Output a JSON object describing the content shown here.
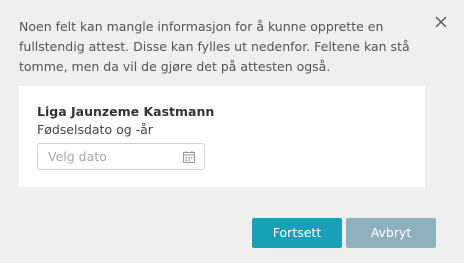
{
  "dialog": {
    "intro_text": "Noen felt kan mangle informasjon for å kunne opprette en fullstendig attest. Disse kan fylles ut nedenfor. Feltene kan stå tomme, men da vil de gjøre det på attesten også.",
    "close_icon": "close-icon"
  },
  "card": {
    "person_name": "Liga Jaunzeme Kastmann",
    "field_label": "Fødselsdato og -år",
    "date_placeholder": "Velg dato",
    "calendar_icon": "calendar-icon"
  },
  "buttons": {
    "continue_label": "Fortsett",
    "cancel_label": "Avbryt"
  },
  "colors": {
    "primary": "#17a1b8",
    "secondary": "#8fb1bd",
    "background": "#efefef"
  }
}
